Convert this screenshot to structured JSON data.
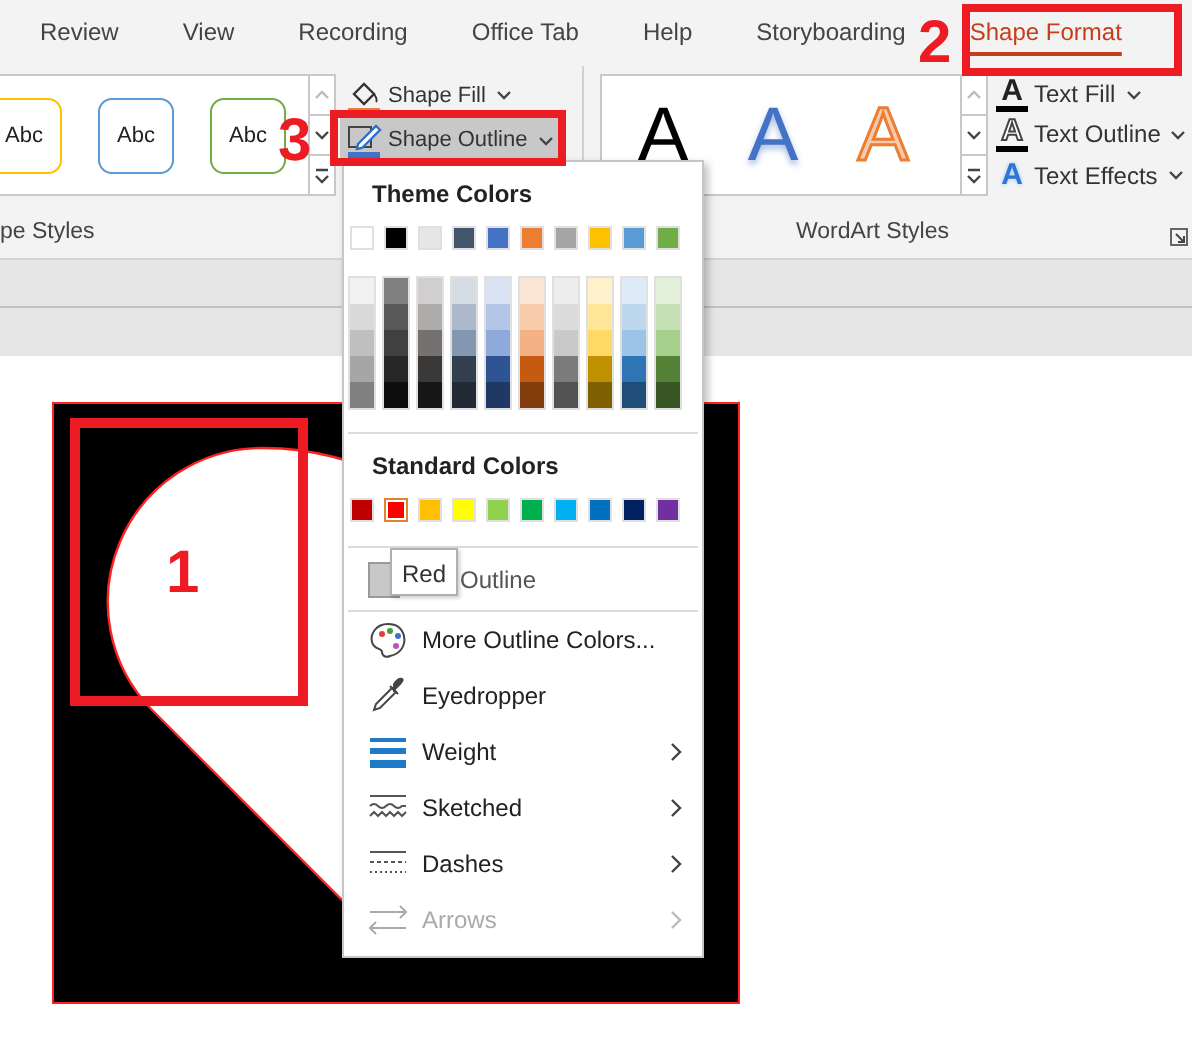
{
  "tabs": [
    {
      "label": "Review",
      "selected": false
    },
    {
      "label": "View",
      "selected": false
    },
    {
      "label": "Recording",
      "selected": false
    },
    {
      "label": "Office Tab",
      "selected": false
    },
    {
      "label": "Help",
      "selected": false
    },
    {
      "label": "Storyboarding",
      "selected": false
    },
    {
      "label": "Shape Format",
      "selected": true
    }
  ],
  "shape_styles": {
    "presets": [
      {
        "label": "Abc",
        "color": "#ffc000"
      },
      {
        "label": "Abc",
        "color": "#5b9bd5"
      },
      {
        "label": "Abc",
        "color": "#70ad47"
      }
    ],
    "group_label": "pe Styles"
  },
  "shape_buttons": [
    {
      "kind": "fill",
      "label": "Shape Fill",
      "selected": false
    },
    {
      "kind": "outline",
      "label": "Shape Outline",
      "selected": true
    }
  ],
  "wordart": {
    "samples": [
      {
        "kind": "black",
        "label": "A"
      },
      {
        "kind": "blue",
        "label": "A"
      },
      {
        "kind": "orange",
        "label": "A"
      }
    ],
    "group_label": "WordArt Styles"
  },
  "text_buttons": [
    {
      "kind": "fill",
      "glyph": "A",
      "label": "Text Fill"
    },
    {
      "kind": "outline",
      "glyph": "A",
      "label": "Text Outline"
    },
    {
      "kind": "effects",
      "glyph": "A",
      "label": "Text Effects"
    }
  ],
  "menu": {
    "theme_heading": "Theme Colors",
    "theme_colors": [
      {
        "color": "#ffffff",
        "selected": false,
        "shades": [
          {
            "color": "#f2f2f2"
          },
          {
            "color": "#d9d9d9"
          },
          {
            "color": "#bfbfbf"
          },
          {
            "color": "#a6a6a6"
          },
          {
            "color": "#808080"
          }
        ]
      },
      {
        "color": "#000000",
        "selected": false,
        "shades": [
          {
            "color": "#808080"
          },
          {
            "color": "#595959"
          },
          {
            "color": "#404040"
          },
          {
            "color": "#262626"
          },
          {
            "color": "#0d0d0d"
          }
        ]
      },
      {
        "color": "#e7e6e6",
        "selected": false,
        "shades": [
          {
            "color": "#d0cece"
          },
          {
            "color": "#aeabab"
          },
          {
            "color": "#757171"
          },
          {
            "color": "#3b3838"
          },
          {
            "color": "#181717"
          }
        ]
      },
      {
        "color": "#44546a",
        "selected": false,
        "shades": [
          {
            "color": "#d6dce4"
          },
          {
            "color": "#adb9ca"
          },
          {
            "color": "#8497b0"
          },
          {
            "color": "#333f4f"
          },
          {
            "color": "#222a35"
          }
        ]
      },
      {
        "color": "#4472c4",
        "selected": false,
        "shades": [
          {
            "color": "#d9e2f3"
          },
          {
            "color": "#b4c6e7"
          },
          {
            "color": "#8eaadb"
          },
          {
            "color": "#2f5496"
          },
          {
            "color": "#1f3864"
          }
        ]
      },
      {
        "color": "#ed7d31",
        "selected": false,
        "shades": [
          {
            "color": "#fbe5d5"
          },
          {
            "color": "#f7cbac"
          },
          {
            "color": "#f4b183"
          },
          {
            "color": "#c55a11"
          },
          {
            "color": "#833c0b"
          }
        ]
      },
      {
        "color": "#a5a5a5",
        "selected": false,
        "shades": [
          {
            "color": "#ededed"
          },
          {
            "color": "#dbdbdb"
          },
          {
            "color": "#c9c9c9"
          },
          {
            "color": "#7b7b7b"
          },
          {
            "color": "#525252"
          }
        ]
      },
      {
        "color": "#ffc000",
        "selected": false,
        "shades": [
          {
            "color": "#fff2cc"
          },
          {
            "color": "#ffe699"
          },
          {
            "color": "#ffd966"
          },
          {
            "color": "#bf9000"
          },
          {
            "color": "#7f6000"
          }
        ]
      },
      {
        "color": "#5b9bd5",
        "selected": false,
        "shades": [
          {
            "color": "#deebf6"
          },
          {
            "color": "#bdd7ee"
          },
          {
            "color": "#9dc3e6"
          },
          {
            "color": "#2e75b5"
          },
          {
            "color": "#1f4e79"
          }
        ]
      },
      {
        "color": "#70ad47",
        "selected": false,
        "shades": [
          {
            "color": "#e2efd9"
          },
          {
            "color": "#c5e0b3"
          },
          {
            "color": "#a8d08d"
          },
          {
            "color": "#538135"
          },
          {
            "color": "#375623"
          }
        ]
      }
    ],
    "standard_heading": "Standard Colors",
    "standard_colors": [
      {
        "color": "#c00000",
        "selected": false
      },
      {
        "color": "#ff0000",
        "selected": true
      },
      {
        "color": "#ffc000",
        "selected": false
      },
      {
        "color": "#ffff00",
        "selected": false
      },
      {
        "color": "#92d050",
        "selected": false
      },
      {
        "color": "#00b050",
        "selected": false
      },
      {
        "color": "#00b0f0",
        "selected": false
      },
      {
        "color": "#0070c0",
        "selected": false
      },
      {
        "color": "#002060",
        "selected": false
      },
      {
        "color": "#7030a0",
        "selected": false
      }
    ],
    "no_outline_label": "Outline",
    "items": [
      {
        "kind": "palette",
        "label": "More Outline Colors...",
        "submenu": false,
        "disabled": false
      },
      {
        "kind": "eyedropper",
        "label": "Eyedropper",
        "submenu": false,
        "disabled": false
      },
      {
        "kind": "weight",
        "label": "Weight",
        "submenu": true,
        "disabled": false
      },
      {
        "kind": "sketched",
        "label": "Sketched",
        "submenu": true,
        "disabled": false
      },
      {
        "kind": "dashes",
        "label": "Dashes",
        "submenu": true,
        "disabled": false
      },
      {
        "kind": "arrows",
        "label": "Arrows",
        "submenu": true,
        "disabled": true
      }
    ]
  },
  "tooltip": "Red",
  "annotations": [
    "1",
    "2",
    "3"
  ]
}
